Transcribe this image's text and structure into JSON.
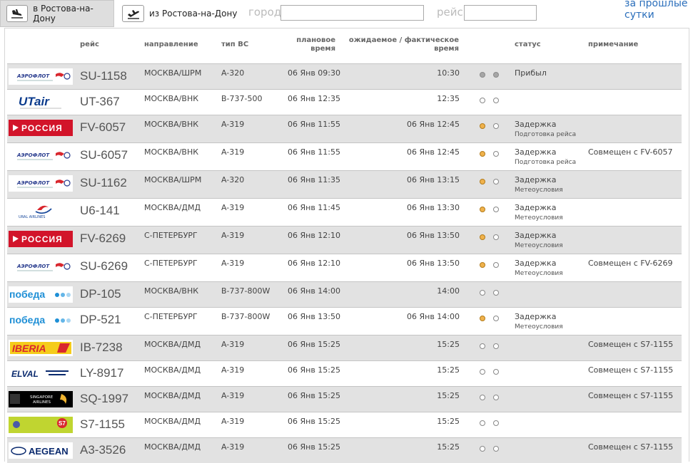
{
  "tabs": {
    "arrivals_label": "в Ростова-на-Дону",
    "departures_label": "из Ростова-на-Дону"
  },
  "filters": {
    "city_label": "город",
    "flight_label": "рейс",
    "city_value": "",
    "flight_value": ""
  },
  "previous_day_link": "за прошлые сутки",
  "columns": {
    "flight": "рейс",
    "direction": "направление",
    "aircraft": "тип ВС",
    "scheduled_line1": "плановое",
    "scheduled_line2": "время",
    "expected_line1": "ожидаемое / фактическое",
    "expected_line2": "время",
    "status": "статус",
    "note": "примечание"
  },
  "logos": {
    "aeroflot": {
      "text": "АЭРОФЛОТ",
      "color": "#2a3d8f",
      "accent": "#d9272e"
    },
    "utair": {
      "text": "UTair",
      "color": "#0a3a8c"
    },
    "rossiya": {
      "text": "РОССИЯ",
      "color": "#d2142a"
    },
    "ural": {
      "text": "URAL AIRLINES",
      "color": "#1a4a9c",
      "accent": "#d9272e"
    },
    "pobeda": {
      "text": "победа",
      "color": "#1e8fd6"
    },
    "iberia": {
      "text": "IBERIA",
      "color": "#d9272e",
      "bg": "#f5cc1b"
    },
    "elal": {
      "text": "ELVAL",
      "color": "#0a2a6e"
    },
    "singapore": {
      "text": "SINGAPORE AIRLINES",
      "color": "#f0b430",
      "bg": "#000000"
    },
    "s7": {
      "text": "S7",
      "color": "#c0d530",
      "accent": "#d9272e"
    },
    "aegean": {
      "text": "AEGEAN",
      "color": "#0a2a6e"
    }
  },
  "flights": [
    {
      "logo": "aeroflot",
      "flight": "SU-1158",
      "direction": "МОСКВА/ШРМ",
      "aircraft": "A-320",
      "scheduled": "06 Янв 09:30",
      "expected": "10:30",
      "dot1": "grey",
      "dot2": "grey",
      "status": "Прибыл",
      "status_detail": "",
      "note": ""
    },
    {
      "logo": "utair",
      "flight": "UT-367",
      "direction": "МОСКВА/ВНК",
      "aircraft": "B-737-500",
      "scheduled": "06 Янв 12:35",
      "expected": "12:35",
      "dot1": "empty",
      "dot2": "empty",
      "status": "",
      "status_detail": "",
      "note": ""
    },
    {
      "logo": "rossiya",
      "flight": "FV-6057",
      "direction": "МОСКВА/ВНК",
      "aircraft": "A-319",
      "scheduled": "06 Янв 11:55",
      "expected": "06 Янв 12:45",
      "dot1": "orange",
      "dot2": "empty",
      "status": "Задержка",
      "status_detail": "Подготовка рейса",
      "note": ""
    },
    {
      "logo": "aeroflot",
      "flight": "SU-6057",
      "direction": "МОСКВА/ВНК",
      "aircraft": "A-319",
      "scheduled": "06 Янв 11:55",
      "expected": "06 Янв 12:45",
      "dot1": "orange",
      "dot2": "empty",
      "status": "Задержка",
      "status_detail": "Подготовка рейса",
      "note": "Совмещен с FV-6057"
    },
    {
      "logo": "aeroflot",
      "flight": "SU-1162",
      "direction": "МОСКВА/ШРМ",
      "aircraft": "A-320",
      "scheduled": "06 Янв 11:35",
      "expected": "06 Янв 13:15",
      "dot1": "orange",
      "dot2": "empty",
      "status": "Задержка",
      "status_detail": "Метеоусловия",
      "note": ""
    },
    {
      "logo": "ural",
      "flight": "U6-141",
      "direction": "МОСКВА/ДМД",
      "aircraft": "A-319",
      "scheduled": "06 Янв 11:45",
      "expected": "06 Янв 13:30",
      "dot1": "orange",
      "dot2": "empty",
      "status": "Задержка",
      "status_detail": "Метеоусловия",
      "note": ""
    },
    {
      "logo": "rossiya",
      "flight": "FV-6269",
      "direction": "С-ПЕТЕРБУРГ",
      "aircraft": "A-319",
      "scheduled": "06 Янв 12:10",
      "expected": "06 Янв 13:50",
      "dot1": "orange",
      "dot2": "empty",
      "status": "Задержка",
      "status_detail": "Метеоусловия",
      "note": ""
    },
    {
      "logo": "aeroflot",
      "flight": "SU-6269",
      "direction": "С-ПЕТЕРБУРГ",
      "aircraft": "A-319",
      "scheduled": "06 Янв 12:10",
      "expected": "06 Янв 13:50",
      "dot1": "orange",
      "dot2": "empty",
      "status": "Задержка",
      "status_detail": "Метеоусловия",
      "note": "Совмещен с FV-6269"
    },
    {
      "logo": "pobeda",
      "flight": "DP-105",
      "direction": "МОСКВА/ВНК",
      "aircraft": "B-737-800W",
      "scheduled": "06 Янв 14:00",
      "expected": "14:00",
      "dot1": "empty",
      "dot2": "empty",
      "status": "",
      "status_detail": "",
      "note": ""
    },
    {
      "logo": "pobeda",
      "flight": "DP-521",
      "direction": "С-ПЕТЕРБУРГ",
      "aircraft": "B-737-800W",
      "scheduled": "06 Янв 13:50",
      "expected": "06 Янв 14:00",
      "dot1": "orange",
      "dot2": "empty",
      "status": "Задержка",
      "status_detail": "Метеоусловия",
      "note": ""
    },
    {
      "logo": "iberia",
      "flight": "IB-7238",
      "direction": "МОСКВА/ДМД",
      "aircraft": "A-319",
      "scheduled": "06 Янв 15:25",
      "expected": "15:25",
      "dot1": "empty",
      "dot2": "empty",
      "status": "",
      "status_detail": "",
      "note": "Совмещен с S7-1155"
    },
    {
      "logo": "elal",
      "flight": "LY-8917",
      "direction": "МОСКВА/ДМД",
      "aircraft": "A-319",
      "scheduled": "06 Янв 15:25",
      "expected": "15:25",
      "dot1": "empty",
      "dot2": "empty",
      "status": "",
      "status_detail": "",
      "note": "Совмещен с S7-1155"
    },
    {
      "logo": "singapore",
      "flight": "SQ-1997",
      "direction": "МОСКВА/ДМД",
      "aircraft": "A-319",
      "scheduled": "06 Янв 15:25",
      "expected": "15:25",
      "dot1": "empty",
      "dot2": "empty",
      "status": "",
      "status_detail": "",
      "note": "Совмещен с S7-1155"
    },
    {
      "logo": "s7",
      "flight": "S7-1155",
      "direction": "МОСКВА/ДМД",
      "aircraft": "A-319",
      "scheduled": "06 Янв 15:25",
      "expected": "15:25",
      "dot1": "empty",
      "dot2": "empty",
      "status": "",
      "status_detail": "",
      "note": ""
    },
    {
      "logo": "aegean",
      "flight": "A3-3526",
      "direction": "МОСКВА/ДМД",
      "aircraft": "A-319",
      "scheduled": "06 Янв 15:25",
      "expected": "15:25",
      "dot1": "empty",
      "dot2": "empty",
      "status": "",
      "status_detail": "",
      "note": "Совмещен с S7-1155"
    }
  ]
}
